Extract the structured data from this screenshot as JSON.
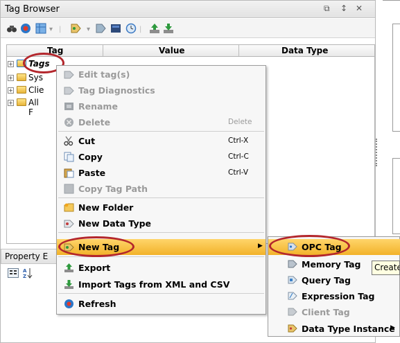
{
  "panel": {
    "title": "Tag Browser",
    "controls": [
      "⧉",
      "↕",
      "✕"
    ]
  },
  "columns": [
    "Tag",
    "Value",
    "Data Type"
  ],
  "tree": [
    {
      "label": "Tags",
      "italic": true
    },
    {
      "label": "Sys"
    },
    {
      "label": "Clie"
    },
    {
      "label": "All F"
    }
  ],
  "property_editor": {
    "title": "Property E"
  },
  "context_menu": {
    "items": [
      {
        "label": "Edit tag(s)",
        "icon": "edit-tags-icon",
        "disabled": true
      },
      {
        "label": "Tag Diagnostics",
        "icon": "tag-diagnostics-icon",
        "disabled": true
      },
      {
        "label": "Rename",
        "icon": "rename-icon",
        "disabled": true
      },
      {
        "label": "Delete",
        "icon": "delete-icon",
        "disabled": true,
        "shortcut": "Delete"
      },
      {
        "label": "Cut",
        "icon": "scissors-icon",
        "shortcut": "Ctrl-X"
      },
      {
        "label": "Copy",
        "icon": "copy-icon",
        "shortcut": "Ctrl-C"
      },
      {
        "label": "Paste",
        "icon": "paste-icon",
        "shortcut": "Ctrl-V"
      },
      {
        "label": "Copy Tag Path",
        "icon": "copy-tag-path-icon",
        "disabled": true
      },
      {
        "label": "New Folder",
        "icon": "new-folder-icon"
      },
      {
        "label": "New Data Type",
        "icon": "new-data-type-icon"
      },
      {
        "label": "New Tag",
        "icon": "new-tag-icon",
        "active": true
      },
      {
        "label": "Export",
        "icon": "export-icon"
      },
      {
        "label": "Import Tags from XML and CSV",
        "icon": "import-icon"
      },
      {
        "label": "Refresh",
        "icon": "refresh-icon"
      }
    ]
  },
  "submenu": {
    "items": [
      {
        "label": "OPC Tag",
        "icon": "opc-tag-icon",
        "active": true
      },
      {
        "label": "Memory Tag",
        "icon": "memory-tag-icon"
      },
      {
        "label": "Query Tag",
        "icon": "query-tag-icon"
      },
      {
        "label": "Expression Tag",
        "icon": "expression-tag-icon"
      },
      {
        "label": "Client Tag",
        "icon": "client-tag-icon",
        "disabled": true
      },
      {
        "label": "Data Type Instance",
        "icon": "data-type-instance-icon"
      }
    ]
  },
  "tooltip": {
    "text": "Create"
  },
  "colors": {
    "highlight": "#f2b22a",
    "circle": "#b3262c"
  }
}
